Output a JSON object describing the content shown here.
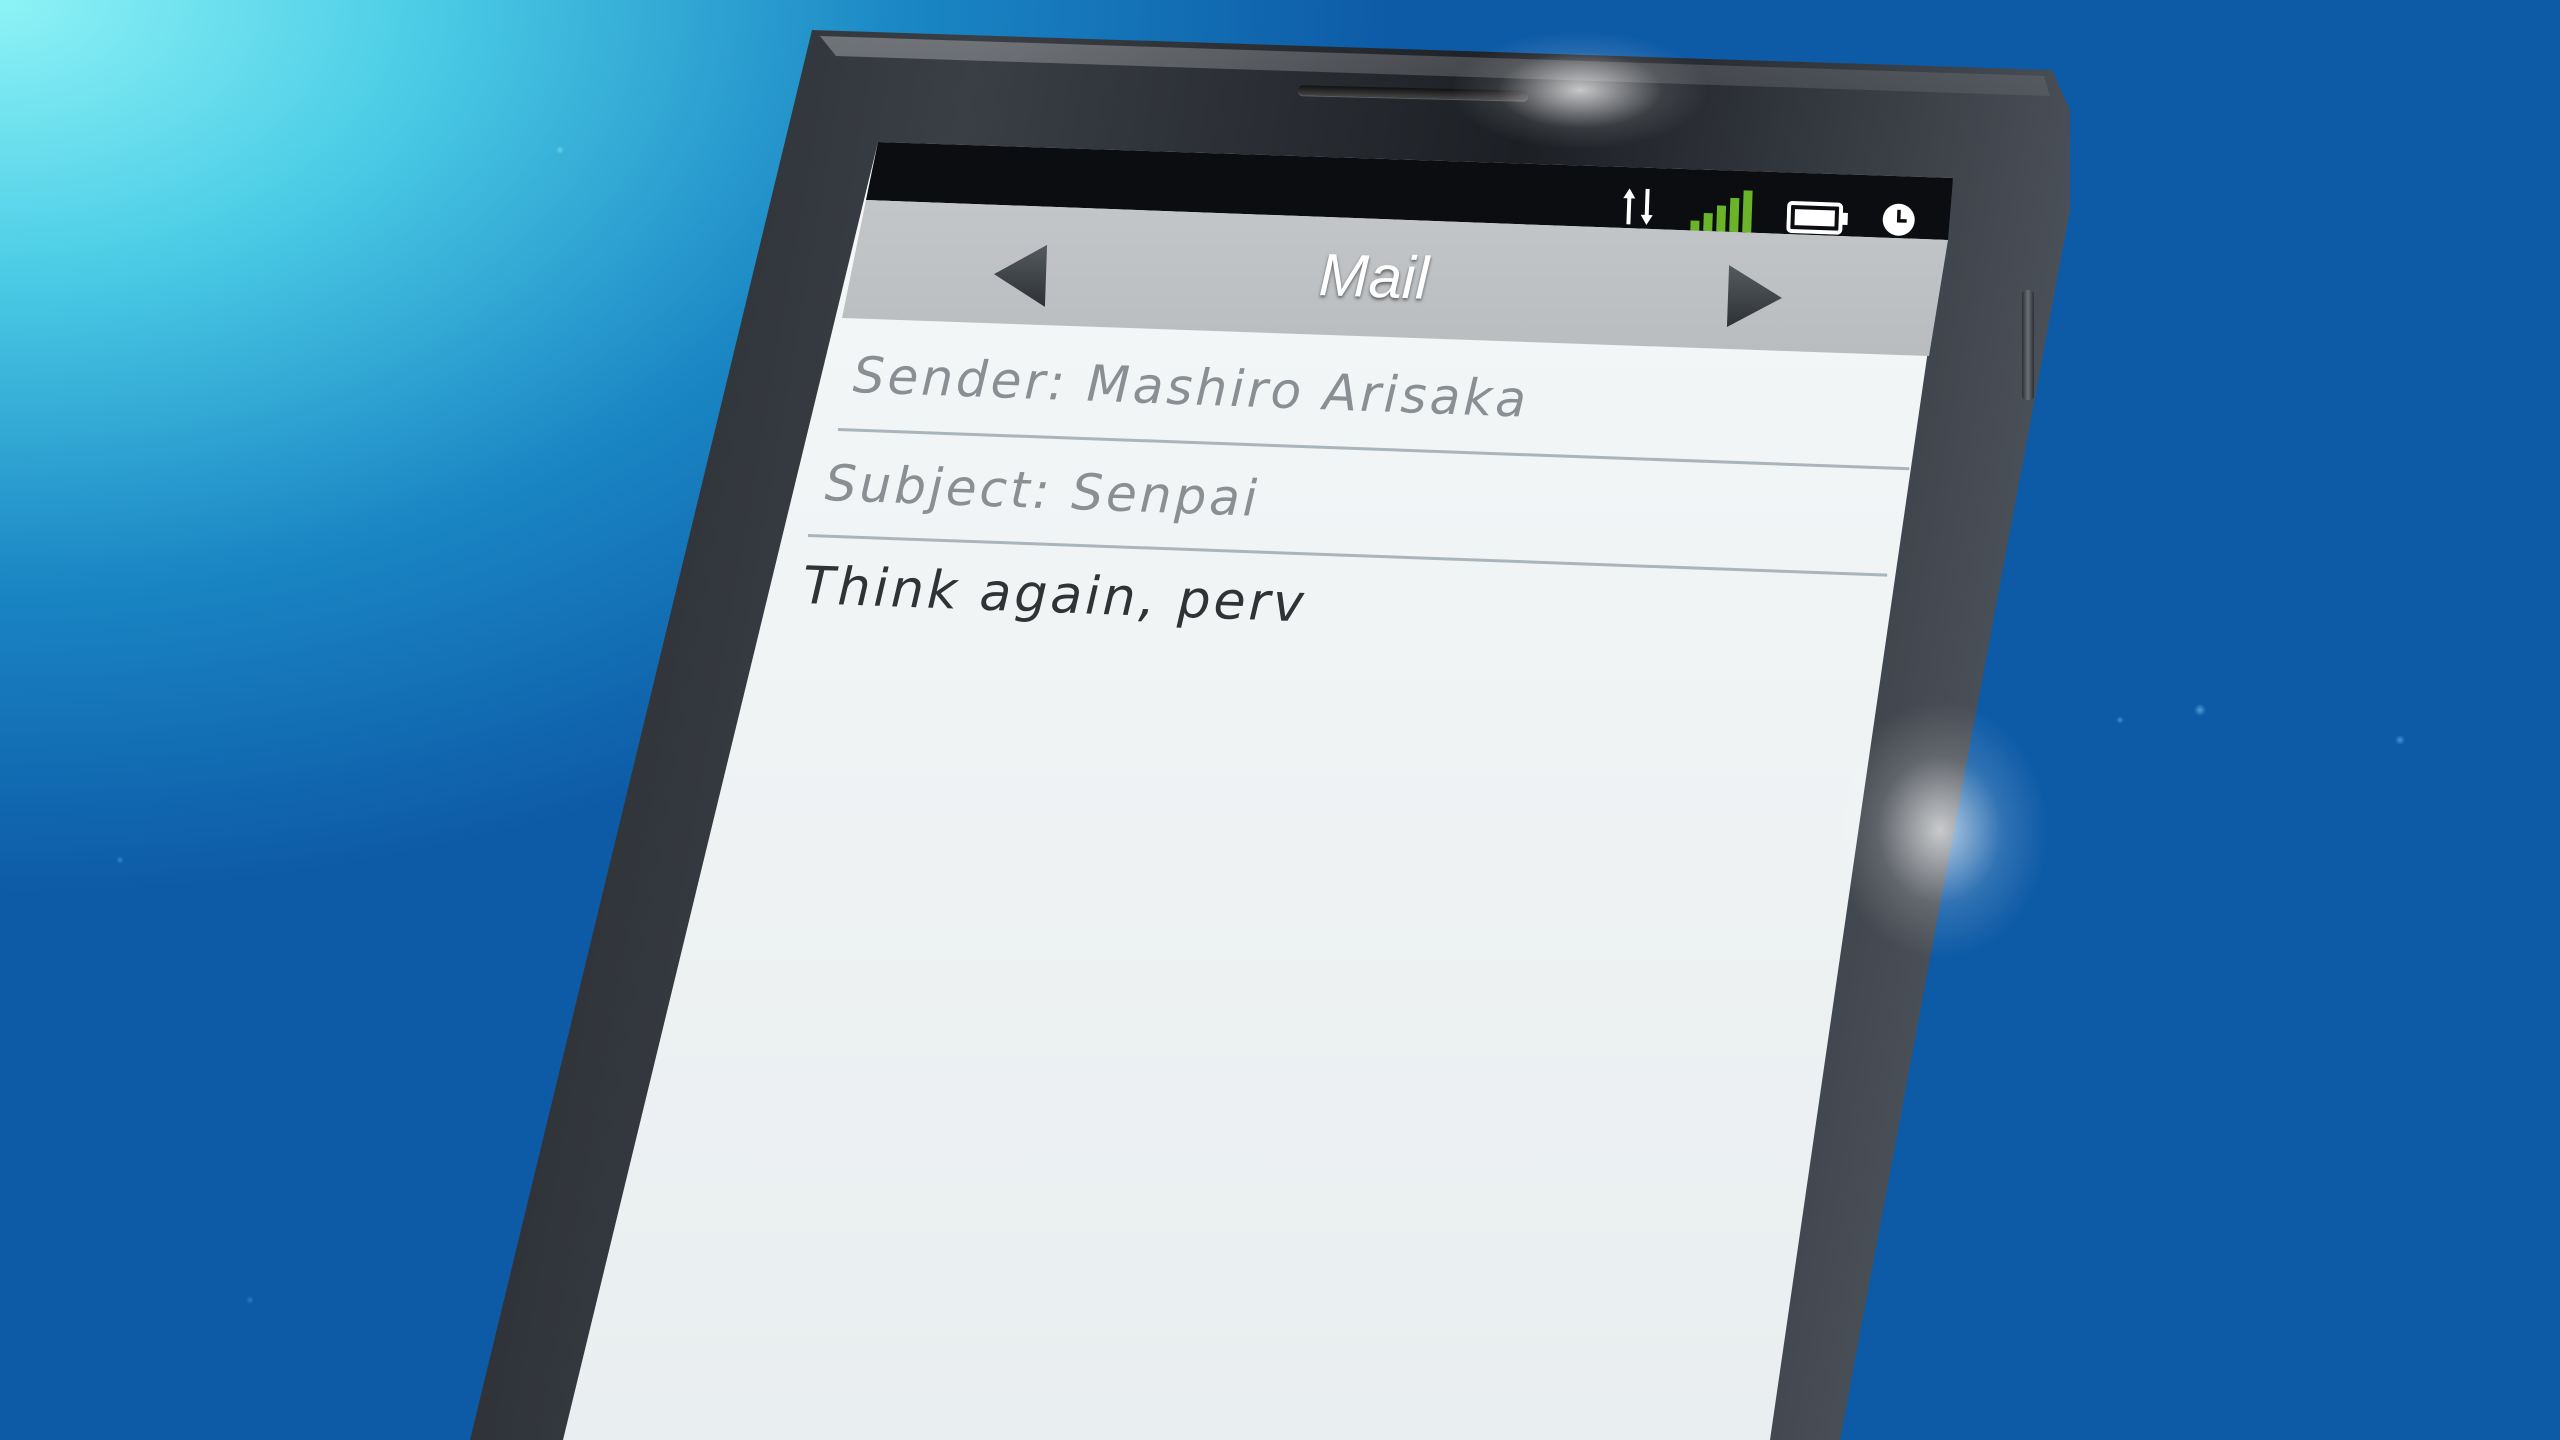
{
  "app": {
    "title": "Mail"
  },
  "status_bar": {
    "icons": [
      "data-sync-icon",
      "signal-strength-icon",
      "battery-icon",
      "clock-icon"
    ],
    "signal_color": "#6ab42a"
  },
  "header": {
    "title": "Mail",
    "prev_icon": "triangle-left-icon",
    "next_icon": "triangle-right-icon"
  },
  "mail": {
    "sender_label": "Sender:",
    "sender_value": "Mashiro Arisaka",
    "subject_label": "Subject:",
    "subject_value": "Senpai",
    "body": "Think again, perv"
  }
}
